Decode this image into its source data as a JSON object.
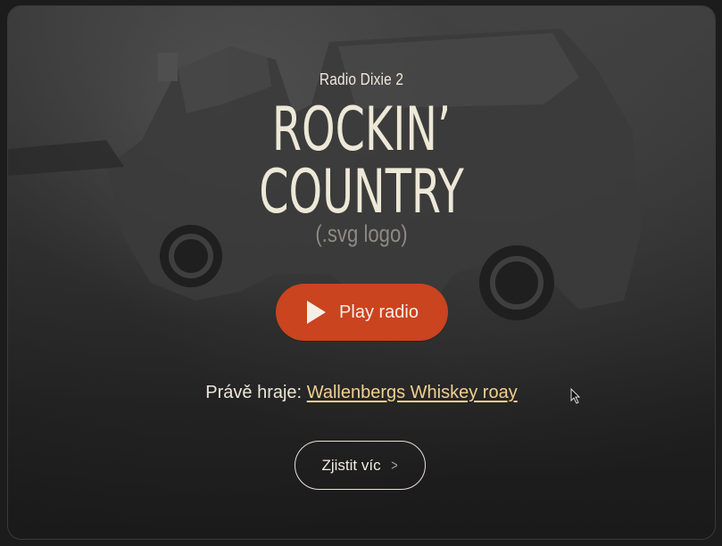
{
  "station_name": "Radio Dixie 2",
  "logo": {
    "line1": "ROCKIN’",
    "line2": "COUNTRY",
    "note": "(.svg logo)"
  },
  "play_button": {
    "label": "Play radio",
    "icon": "play-icon"
  },
  "now_playing": {
    "prefix": "Právě hraje:",
    "track": "Wallenbergs Whiskey roay"
  },
  "more_button": {
    "label": "Zjistit víc",
    "icon": "chevron-right-icon"
  },
  "colors": {
    "accent": "#c9441f",
    "link": "#f0d08f",
    "text": "#efe9dc",
    "background": "#202020"
  }
}
